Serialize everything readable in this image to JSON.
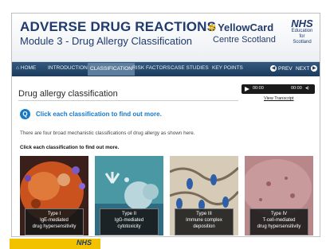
{
  "header": {
    "title": "ADVERSE DRUG REACTIONS",
    "subtitle": "Module 3 - Drug Allergy Classification",
    "partner_name": "YellowCard",
    "partner_sub": "Centre Scotland",
    "nhs_logo": "NHS",
    "nhs_sub": [
      "Education",
      "for",
      "Scotland"
    ]
  },
  "nav": {
    "items": [
      "HOME",
      "INTRODUCTION",
      "CLASSIFICATION",
      "RISK FACTORS",
      "CASE STUDIES",
      "KEY POINTS"
    ],
    "active": "CLASSIFICATION",
    "prev_label": "PREV",
    "next_label": "NEXT"
  },
  "content": {
    "title": "Drug allergy classification",
    "hint": "Click each classification to find out more.",
    "intro": "There are four broad mechanistic classifications of drug allergy as shown here.",
    "instruction": "Click each classification to find out more."
  },
  "player": {
    "time_start": "00:00",
    "time_end": "00:00",
    "transcript_link": "View Transcript"
  },
  "cards": [
    {
      "lines": [
        "Type I",
        "IgE-mediated",
        "drug hypersensitivity"
      ]
    },
    {
      "lines": [
        "Type II",
        "IgG-mediated",
        "cytotoxicity"
      ]
    },
    {
      "lines": [
        "Type III",
        "Immune complex",
        "deposition"
      ]
    },
    {
      "lines": [
        "Type IV",
        "T-cell-mediated",
        "drug hypersensitivity"
      ]
    }
  ],
  "lower_logo": "NHS",
  "colors": {
    "nav": "#1d3b5c",
    "title": "#1e3a6e",
    "hint": "#1679c8"
  }
}
